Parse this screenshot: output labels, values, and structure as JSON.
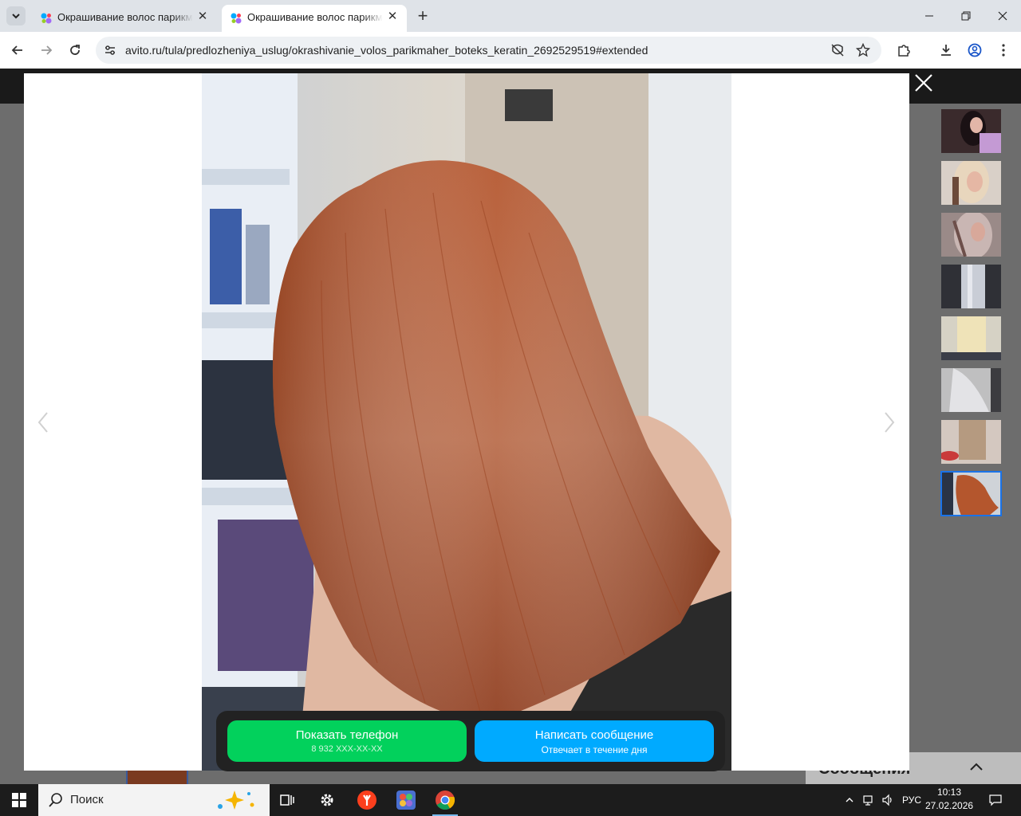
{
  "browser": {
    "tabs": [
      {
        "title": "Окрашивание волос парикмахер",
        "active": false
      },
      {
        "title": "Окрашивание волос парикмахер",
        "active": true
      }
    ],
    "url_host": "avito.ru",
    "url_path": "/tula/predlozheniya_uslug/okrashivanie_volos_parikmaher_boteks_keratin_2692529519#extended"
  },
  "page": {
    "messages_panel_title": "Сообщения"
  },
  "lightbox": {
    "thumbnail_count": 8,
    "selected_thumbnail_index": 7,
    "thumbnail_icons": [
      "hair-photo-1",
      "hair-photo-2",
      "hair-photo-3",
      "hair-photo-4",
      "hair-photo-5",
      "hair-photo-6",
      "hair-photo-7",
      "hair-photo-8"
    ],
    "cta": {
      "phone_label": "Показать телефон",
      "phone_masked": "8 932 XXX-XX-XX",
      "message_label": "Написать сообщение",
      "message_sub": "Отвечает в течение дня"
    },
    "colors": {
      "phone_button": "#02d15c",
      "message_button": "#00aaff"
    }
  },
  "taskbar": {
    "search_placeholder": "Поиск",
    "language": "РУС",
    "time": "10:13",
    "date": "27.02.2026"
  }
}
